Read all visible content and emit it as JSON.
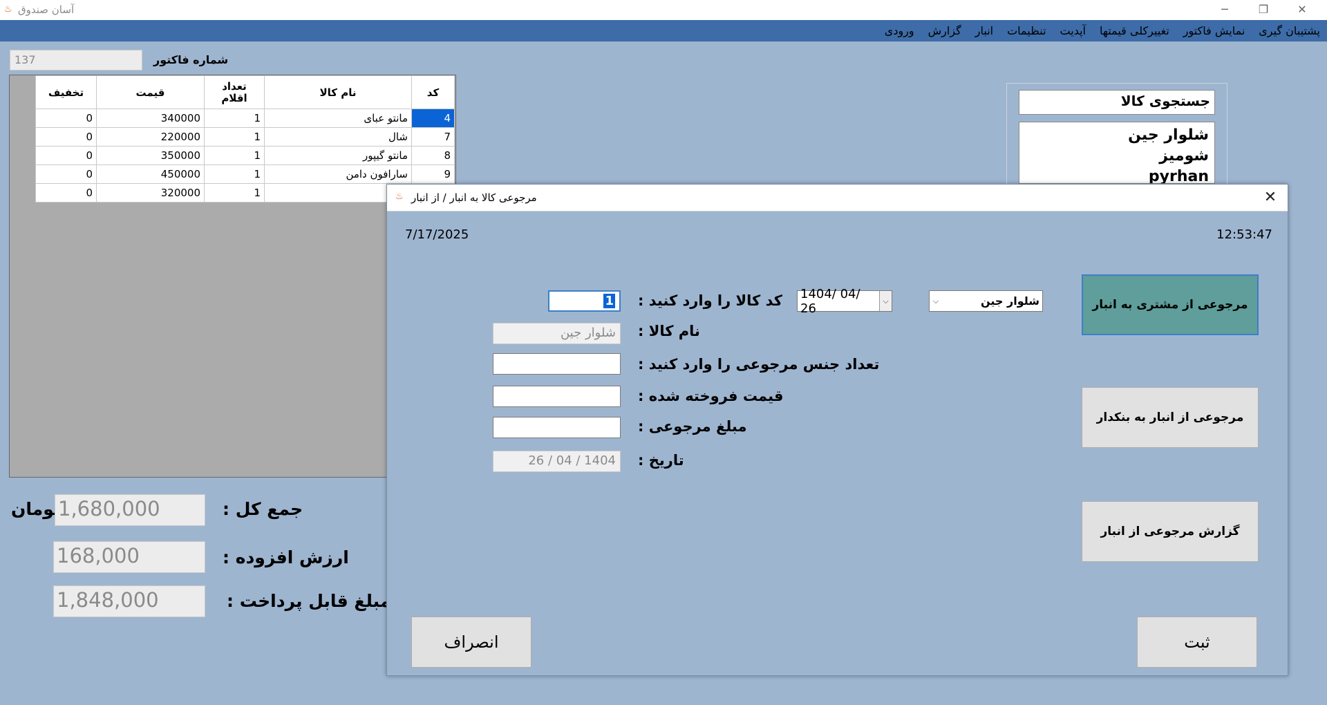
{
  "app": {
    "title": "آسان صندوق",
    "icon": "app-icon"
  },
  "window_controls": {
    "minimize": "─",
    "restore": "❐",
    "close": "✕"
  },
  "menu": [
    "ورودی",
    "گزارش",
    "انبار",
    "تنظیمات",
    "آپدیت",
    "تغییرکلی قیمتها",
    "نمایش فاکتور",
    "پشتیبان گیری"
  ],
  "invoice": {
    "number_label": "شماره فاکتور",
    "number_value": "137"
  },
  "grid": {
    "headers": {
      "code": "کد",
      "name": "نام کالا",
      "qty_line1": "تعداد",
      "qty_line2": "اقلام",
      "price": "قیمت",
      "discount": "تخفیف"
    },
    "rows": [
      {
        "code": "4",
        "name": "مانتو عبای",
        "qty": "1",
        "price": "340000",
        "discount": "0"
      },
      {
        "code": "7",
        "name": "شال",
        "qty": "1",
        "price": "220000",
        "discount": "0"
      },
      {
        "code": "8",
        "name": "مانتو گیپور",
        "qty": "1",
        "price": "350000",
        "discount": "0"
      },
      {
        "code": "9",
        "name": "سارافون دامن",
        "qty": "1",
        "price": "450000",
        "discount": "0"
      },
      {
        "code": "",
        "name": "",
        "qty": "1",
        "price": "320000",
        "discount": "0"
      }
    ]
  },
  "totals": {
    "total_label": "جمع کل :",
    "total_value": "1,680,000",
    "currency": "تومان",
    "vat_label": "ارزش افزوده :",
    "vat_value": "168,000",
    "payable_label": "مبلغ قابل پرداخت :",
    "payable_value": "1,848,000"
  },
  "search": {
    "label": "جستجوی کالا",
    "results": [
      "شلوار جین",
      "شومیز",
      "pyrhan"
    ]
  },
  "dialog": {
    "title": "مرجوعی کالا  به انبار / از انبار",
    "date": "7/17/2025",
    "time": "12:53:47",
    "product_combo": "شلوار جین",
    "date_picker": "1404/ 04/ 26",
    "code_label": "کد کالا را وارد کنید :",
    "code_value": "1",
    "name_label": "نام کالا :",
    "name_value": "شلوار جین",
    "qty_label": "تعداد جنس مرجوعی را  وارد کنید :",
    "qty_value": "",
    "sold_price_label": "قیمت فروخته شده :",
    "sold_price_value": "",
    "refund_amount_label": "مبلغ مرجوعی :",
    "refund_amount_value": "",
    "date_label": "تاریخ :",
    "date_value": "26 / 04 / 1404",
    "btn_customer_to_store": "مرجوعی از مشتری به انبار",
    "btn_store_to_supplier": "مرجوعی از انبار به  بنکدار",
    "btn_report": "گزارش مرجوعی از انبار",
    "btn_cancel": "انصراف",
    "btn_submit": "ثبت"
  }
}
